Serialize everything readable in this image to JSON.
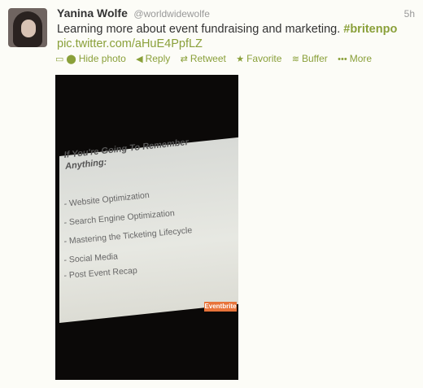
{
  "tweet": {
    "fullname": "Yanina Wolfe",
    "username": "@worldwidewolfe",
    "time": "5h",
    "text": "Learning more about event fundraising and marketing.",
    "hashtag": "#britenpo",
    "link": "pic.twitter.com/aHuE4PpfLZ"
  },
  "actions": {
    "hide_photo": "Hide photo",
    "reply": "Reply",
    "retweet": "Retweet",
    "favorite": "Favorite",
    "buffer": "Buffer",
    "more": "More"
  },
  "photo": {
    "slide_title_line1": "If You're Going To Remember",
    "slide_title_line2": "Anything:",
    "items": [
      "- Website Optimization",
      "- Search Engine Optimization",
      "- Mastering the Ticketing Lifecycle",
      "- Social Media",
      "- Post Event Recap"
    ],
    "logo_text": "Eventbrite"
  },
  "colors": {
    "accent": "#8aa03a",
    "name": "#333333",
    "muted": "#999999",
    "photo_bg": "#0b0908"
  }
}
